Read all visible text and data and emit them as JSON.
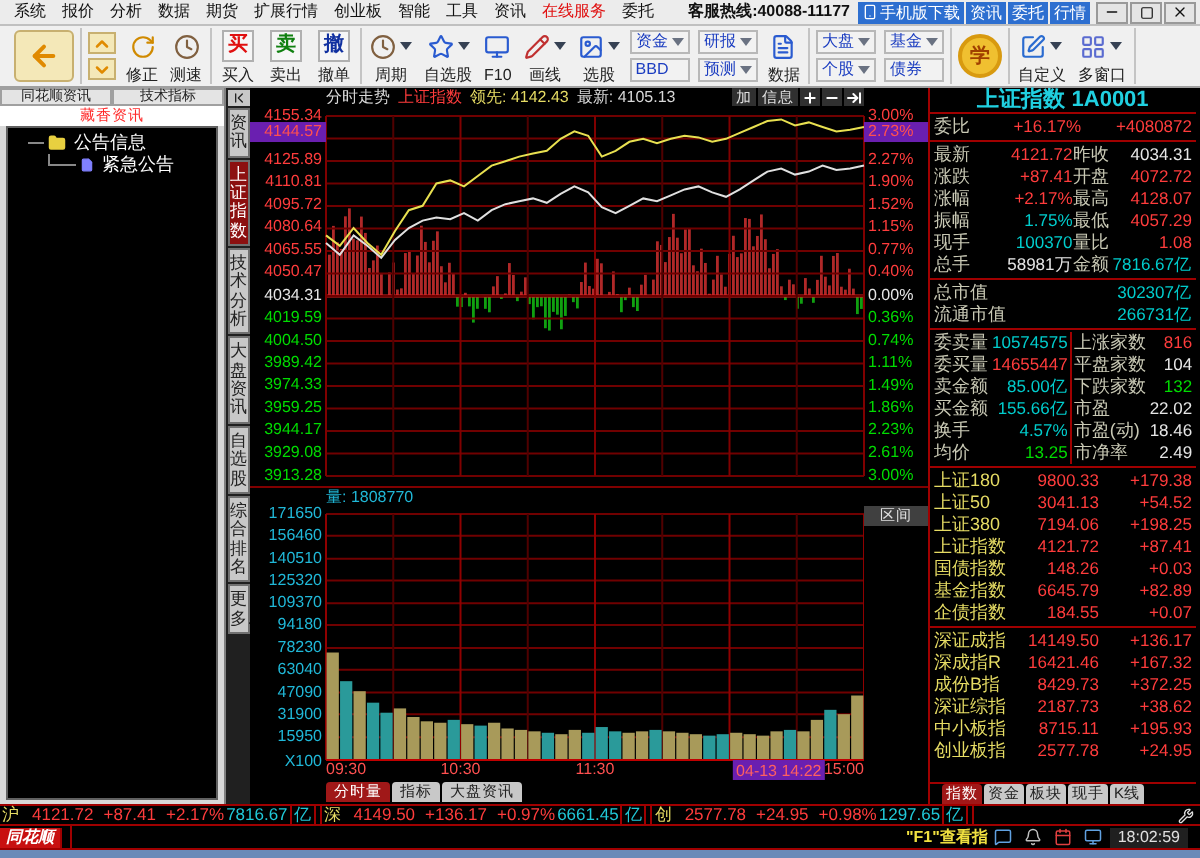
{
  "menu_bar": {
    "items": [
      {
        "label": "系统",
        "highlighted": false
      },
      {
        "label": "报价",
        "highlighted": false
      },
      {
        "label": "分析",
        "highlighted": false
      },
      {
        "label": "数据",
        "highlighted": false
      },
      {
        "label": "期货",
        "highlighted": false
      },
      {
        "label": "扩展行情",
        "highlighted": false
      },
      {
        "label": "创业板",
        "highlighted": false
      },
      {
        "label": "智能",
        "highlighted": false
      },
      {
        "label": "工具",
        "highlighted": false
      },
      {
        "label": "资讯",
        "highlighted": false
      },
      {
        "label": "在线服务",
        "highlighted": true
      },
      {
        "label": "委托",
        "highlighted": false
      }
    ],
    "hotline": "客服热线:40088-11177",
    "buttons": [
      "手机版下载",
      "资讯",
      "委托",
      "行情"
    ]
  },
  "toolbar": {
    "groups": [
      [
        {
          "kind": "back"
        }
      ],
      [
        {
          "kind": "updown"
        },
        {
          "kind": "refresh",
          "label": "修正",
          "menu": false
        },
        {
          "kind": "clock",
          "label": "测速",
          "menu": false
        }
      ],
      [
        {
          "kind": "buy",
          "glyph": "买",
          "label": "买入"
        },
        {
          "kind": "sell",
          "glyph": "卖",
          "label": "卖出"
        },
        {
          "kind": "cancel",
          "glyph": "撤",
          "label": "撤单"
        }
      ],
      [
        {
          "kind": "clock",
          "label": "周期",
          "menu": true
        },
        {
          "kind": "star",
          "label": "自选股",
          "menu": true
        },
        {
          "kind": "f10",
          "label": "F10",
          "menu": false
        },
        {
          "kind": "pen",
          "label": "画线",
          "menu": true
        },
        {
          "kind": "picture",
          "label": "选股",
          "menu": true
        },
        {
          "kind": "pair",
          "top": {
            "label": "资金",
            "menu": true
          },
          "bottom": {
            "label": "BBD",
            "menu": false
          }
        },
        {
          "kind": "pair",
          "top": {
            "label": "研报",
            "menu": true
          },
          "bottom": {
            "label": "预测",
            "menu": true
          }
        },
        {
          "kind": "pe",
          "label": "数据",
          "menu": false
        }
      ],
      [
        {
          "kind": "pair",
          "top": {
            "label": "大盘",
            "menu": true
          },
          "bottom": {
            "label": "个股",
            "menu": true
          }
        },
        {
          "kind": "pair",
          "top": {
            "label": "基金",
            "menu": true
          },
          "bottom": {
            "label": "债券",
            "menu": false
          }
        }
      ],
      [
        {
          "kind": "learn",
          "glyph": "学"
        }
      ],
      [
        {
          "kind": "custom",
          "label": "自定义",
          "menu": true
        },
        {
          "kind": "windows",
          "label": "多窗口",
          "menu": true
        }
      ]
    ]
  },
  "left_panel": {
    "tabs": [
      "同花顺资讯",
      "技术指标"
    ],
    "header": "藏香资讯",
    "tree": [
      {
        "label": "公告信息",
        "children": [
          {
            "label": "紧急公告"
          }
        ]
      }
    ]
  },
  "side_tabs": [
    {
      "label": "资讯",
      "selected": false
    },
    {
      "label": "上证指数",
      "selected": true
    },
    {
      "label": "技术分析",
      "selected": false
    },
    {
      "label": "大盘资讯",
      "selected": false
    },
    {
      "label": "自选股",
      "selected": false
    },
    {
      "label": "综合排名",
      "selected": false
    },
    {
      "label": "更多.",
      "selected": false
    }
  ],
  "chart_header": {
    "title": "分时走势",
    "symbol": "上证指数",
    "lead": "领先: 4142.43",
    "latest": "最新: 4105.13",
    "buttons": [
      {
        "kind": "text",
        "label": "加"
      },
      {
        "kind": "text",
        "label": "信息"
      },
      {
        "kind": "plus"
      },
      {
        "kind": "minus"
      },
      {
        "kind": "exit"
      }
    ]
  },
  "price_chart": {
    "chart_data": {
      "type": "line",
      "grid": true,
      "ylim": [
        3913.28,
        4155.34
      ],
      "yticks": [
        4155.34,
        4125.89,
        4110.81,
        4095.72,
        4080.64,
        4065.55,
        4050.47,
        4034.31,
        4019.59,
        {
          "value": 4004.5,
          "label": "4004.50"
        },
        3989.42,
        3974.33,
        3959.25,
        3944.17,
        3929.08,
        3913.28
      ],
      "series": [
        {
          "color": "#e0e0e0",
          "values": [
            4070,
            4062,
            4075,
            4068,
            4060,
            4072,
            4080,
            4085,
            4087,
            4086,
            4090,
            4085,
            4092,
            4096,
            4098,
            4100,
            4097,
            4103,
            4108,
            4104,
            4094,
            4090,
            4095,
            4100,
            4098,
            4102,
            4106,
            4108,
            4104,
            4101,
            4106,
            4112,
            4118,
            4120,
            4116,
            4118,
            4122,
            4119,
            4120,
            4122
          ]
        },
        {
          "color": "#e8e050",
          "values": [
            4075,
            4068,
            4080,
            4070,
            4062,
            4078,
            4092,
            4095,
            4110,
            4112,
            4108,
            4115,
            4122,
            4125,
            4128,
            4130,
            4132,
            4140,
            4145,
            4142,
            4128,
            4132,
            4138,
            4140,
            4137,
            4140,
            4142,
            4141,
            4138,
            4140,
            4144,
            4148,
            4152,
            4153,
            4149,
            4151,
            4148,
            4145,
            4146,
            4148
          ]
        }
      ]
    },
    "percent_ticks": [
      {
        "label": "3.00%",
        "kind": "up"
      },
      {
        "label": "2.27%",
        "kind": "up"
      },
      {
        "label": "1.90%",
        "kind": "up"
      },
      {
        "label": "1.52%",
        "kind": "up"
      },
      {
        "label": "1.15%",
        "kind": "up"
      },
      {
        "label": "0.77%",
        "kind": "up"
      },
      {
        "label": "0.40%",
        "kind": "up"
      },
      {
        "label": "0.00%",
        "kind": "flat"
      },
      {
        "label": "0.36%",
        "kind": "down"
      },
      {
        "label": "0.74%",
        "kind": "down"
      },
      {
        "label": "1.11%",
        "kind": "down"
      },
      {
        "label": "1.49%",
        "kind": "down"
      },
      {
        "label": "1.86%",
        "kind": "down"
      },
      {
        "label": "2.23%",
        "kind": "down"
      },
      {
        "label": "2.61%",
        "kind": "down"
      },
      {
        "label": "3.00%",
        "kind": "down"
      }
    ],
    "cursor": {
      "price": "4144.57",
      "percent": "2.73%"
    }
  },
  "volume_chart": {
    "label": "量: 1808770",
    "unit": "X100",
    "cursor_time": "04-13 14:22",
    "range_button": "区间",
    "time_labels": [
      "09:30",
      "10:30",
      "11:30",
      "15:00"
    ],
    "chart_data": {
      "type": "bar",
      "grid": true,
      "ylim": [
        0,
        171650
      ],
      "yticks": [
        171650,
        156460,
        140510,
        125320,
        109370,
        94180,
        78230,
        63040,
        47090,
        31900,
        15950
      ],
      "series": [
        {
          "values": [
            75000,
            55000,
            48000,
            40000,
            33000,
            36000,
            30000,
            27000,
            26000,
            28000,
            25000,
            24000,
            26000,
            22000,
            21000,
            20000,
            19000,
            18000,
            21000,
            19000,
            23000,
            20000,
            19000,
            20000,
            21000,
            20000,
            19000,
            18000,
            17000,
            18000,
            19000,
            18000,
            17000,
            20000,
            21000,
            20000,
            28000,
            35000,
            32000,
            45000
          ]
        }
      ]
    },
    "tabs": [
      {
        "label": "分时量",
        "selected": true
      },
      {
        "label": "指标",
        "selected": false
      },
      {
        "label": "大盘资讯",
        "selected": false
      }
    ]
  },
  "quote_panel": {
    "title": "上证指数 1A0001",
    "sections": [
      {
        "divided": false,
        "rows": [
          [
            {
              "text": "委比",
              "kind": "label"
            },
            {
              "text": "+16.17%",
              "kind": "up"
            },
            {
              "text": "+4080872",
              "kind": "up"
            }
          ]
        ]
      },
      {
        "divided": false,
        "rows": [
          [
            {
              "text": "最新",
              "kind": "label"
            },
            {
              "text": "4121.72",
              "kind": "up"
            },
            {
              "text": "昨收",
              "kind": "label"
            },
            {
              "text": "4034.31",
              "kind": "flat"
            }
          ],
          [
            {
              "text": "涨跌",
              "kind": "label"
            },
            {
              "text": "+87.41",
              "kind": "up"
            },
            {
              "text": "开盘",
              "kind": "label"
            },
            {
              "text": "4072.72",
              "kind": "up"
            }
          ],
          [
            {
              "text": "涨幅",
              "kind": "label"
            },
            {
              "text": "+2.17%",
              "kind": "up"
            },
            {
              "text": "最高",
              "kind": "label"
            },
            {
              "text": "4128.07",
              "kind": "up"
            }
          ],
          [
            {
              "text": "振幅",
              "kind": "label"
            },
            {
              "text": "1.75%",
              "kind": "amount"
            },
            {
              "text": "最低",
              "kind": "label"
            },
            {
              "text": "4057.29",
              "kind": "up"
            }
          ],
          [
            {
              "text": "现手",
              "kind": "label"
            },
            {
              "text": "100370",
              "kind": "amount"
            },
            {
              "text": "量比",
              "kind": "label"
            },
            {
              "text": "1.08",
              "kind": "up"
            }
          ],
          [
            {
              "text": "总手",
              "kind": "label"
            },
            {
              "text": "58981万",
              "kind": "flat"
            },
            {
              "text": "金额",
              "kind": "label"
            },
            {
              "text": "7816.67亿",
              "kind": "amount"
            }
          ]
        ]
      },
      {
        "rows": [
          [
            {
              "text": "总市值",
              "kind": "label"
            },
            {
              "text": "302307亿",
              "kind": "amount"
            }
          ],
          [
            {
              "text": "流通市值",
              "kind": "label"
            },
            {
              "text": "266731亿",
              "kind": "amount"
            }
          ]
        ]
      },
      {
        "divided": true,
        "rows": [
          [
            {
              "text": "委卖量",
              "kind": "label"
            },
            {
              "text": "10574575",
              "kind": "amount"
            },
            {
              "text": "上涨家数",
              "kind": "label"
            },
            {
              "text": "816",
              "kind": "up"
            }
          ],
          [
            {
              "text": "委买量",
              "kind": "label"
            },
            {
              "text": "14655447",
              "kind": "up"
            },
            {
              "text": "平盘家数",
              "kind": "label"
            },
            {
              "text": "104",
              "kind": "flat"
            }
          ],
          [
            {
              "text": "卖金额",
              "kind": "label"
            },
            {
              "text": "85.00亿",
              "kind": "amount"
            },
            {
              "text": "下跌家数",
              "kind": "label"
            },
            {
              "text": "132",
              "kind": "down"
            }
          ],
          [
            {
              "text": "买金额",
              "kind": "label"
            },
            {
              "text": "155.66亿",
              "kind": "amount"
            },
            {
              "text": "市盈",
              "kind": "label"
            },
            {
              "text": "22.02",
              "kind": "flat"
            }
          ],
          [
            {
              "text": "换手",
              "kind": "label"
            },
            {
              "text": "4.57%",
              "kind": "amount"
            },
            {
              "text": "市盈(动)",
              "kind": "label"
            },
            {
              "text": "18.46",
              "kind": "flat"
            }
          ],
          [
            {
              "text": "均价",
              "kind": "label"
            },
            {
              "text": "13.25",
              "kind": "down"
            },
            {
              "text": "市净率",
              "kind": "label"
            },
            {
              "text": "2.49",
              "kind": "flat"
            }
          ]
        ]
      },
      {
        "divided": false,
        "rows": [
          [
            {
              "text": "上证180",
              "kind": "name"
            },
            {
              "text": "9800.33",
              "kind": "up"
            },
            {
              "text": "+179.38",
              "kind": "up"
            }
          ],
          [
            {
              "text": "上证50",
              "kind": "name"
            },
            {
              "text": "3041.13",
              "kind": "up"
            },
            {
              "text": "+54.52",
              "kind": "up"
            }
          ],
          [
            {
              "text": "上证380",
              "kind": "name"
            },
            {
              "text": "7194.06",
              "kind": "up"
            },
            {
              "text": "+198.25",
              "kind": "up"
            }
          ],
          [
            {
              "text": "上证指数",
              "kind": "name"
            },
            {
              "text": "4121.72",
              "kind": "up"
            },
            {
              "text": "+87.41",
              "kind": "up"
            }
          ],
          [
            {
              "text": "国债指数",
              "kind": "name"
            },
            {
              "text": "148.26",
              "kind": "up"
            },
            {
              "text": "+0.03",
              "kind": "up"
            }
          ],
          [
            {
              "text": "基金指数",
              "kind": "name"
            },
            {
              "text": "6645.79",
              "kind": "up"
            },
            {
              "text": "+82.89",
              "kind": "up"
            }
          ],
          [
            {
              "text": "企债指数",
              "kind": "name"
            },
            {
              "text": "184.55",
              "kind": "up"
            },
            {
              "text": "+0.07",
              "kind": "up"
            }
          ]
        ]
      },
      {
        "divided": false,
        "rows": [
          [
            {
              "text": "深证成指",
              "kind": "name"
            },
            {
              "text": "14149.50",
              "kind": "up"
            },
            {
              "text": "+136.17",
              "kind": "up"
            }
          ],
          [
            {
              "text": "深成指R",
              "kind": "name"
            },
            {
              "text": "16421.46",
              "kind": "up"
            },
            {
              "text": "+167.32",
              "kind": "up"
            }
          ],
          [
            {
              "text": "成份B指",
              "kind": "name"
            },
            {
              "text": "8429.73",
              "kind": "up"
            },
            {
              "text": "+372.25",
              "kind": "up"
            }
          ],
          [
            {
              "text": "深证综指",
              "kind": "name"
            },
            {
              "text": "2187.73",
              "kind": "up"
            },
            {
              "text": "+38.62",
              "kind": "up"
            }
          ],
          [
            {
              "text": "中小板指",
              "kind": "name"
            },
            {
              "text": "8715.11",
              "kind": "up"
            },
            {
              "text": "+195.93",
              "kind": "up"
            }
          ],
          [
            {
              "text": "创业板指",
              "kind": "name"
            },
            {
              "text": "2577.78",
              "kind": "up"
            },
            {
              "text": "+24.95",
              "kind": "up"
            }
          ]
        ]
      }
    ],
    "tabs": [
      {
        "label": "指数",
        "selected": true
      },
      {
        "label": "资金",
        "selected": false
      },
      {
        "label": "板块",
        "selected": false
      },
      {
        "label": "现手",
        "selected": false
      },
      {
        "label": "K线",
        "selected": false
      }
    ]
  },
  "ticker": [
    {
      "market": "沪",
      "price": "4121.72",
      "change": "+87.41",
      "percent": "+2.17%",
      "amount": "7816.67",
      "unit": "亿"
    },
    {
      "market": "深",
      "price": "4149.50",
      "change": "+136.17",
      "percent": "+0.97%",
      "amount": "6661.45",
      "unit": "亿"
    },
    {
      "market": "创",
      "price": "2577.78",
      "change": "+24.95",
      "percent": "+0.98%",
      "amount": "1297.65",
      "unit": "亿"
    }
  ],
  "status_bar": {
    "logo": "同花顺",
    "hint": "\"F1\"查看指",
    "time": "18:02:59"
  }
}
